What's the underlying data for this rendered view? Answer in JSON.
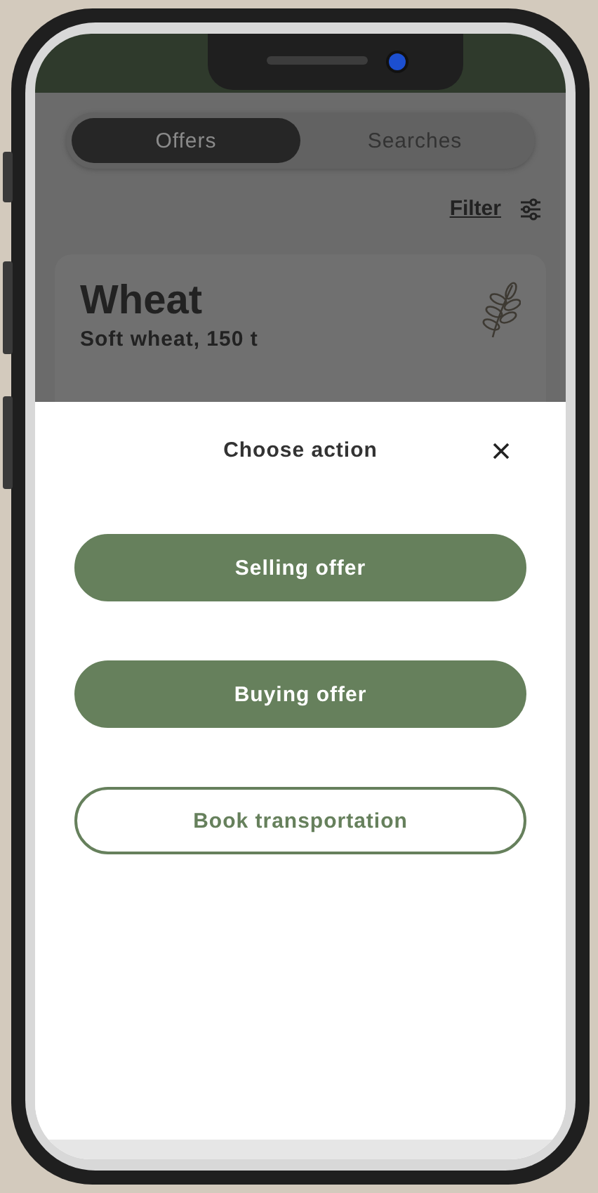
{
  "tabs": [
    {
      "label": "Offers",
      "selected": true
    },
    {
      "label": "Searches",
      "selected": false
    }
  ],
  "filter": {
    "label": "Filter"
  },
  "card": {
    "title": "Wheat",
    "subtitle": "Soft wheat, 150 t"
  },
  "sheet": {
    "title": "Choose action",
    "actions": [
      {
        "label": "Selling offer",
        "kind": "filled"
      },
      {
        "label": "Buying offer",
        "kind": "filled"
      },
      {
        "label": "Book transportation",
        "kind": "outlined"
      }
    ]
  }
}
